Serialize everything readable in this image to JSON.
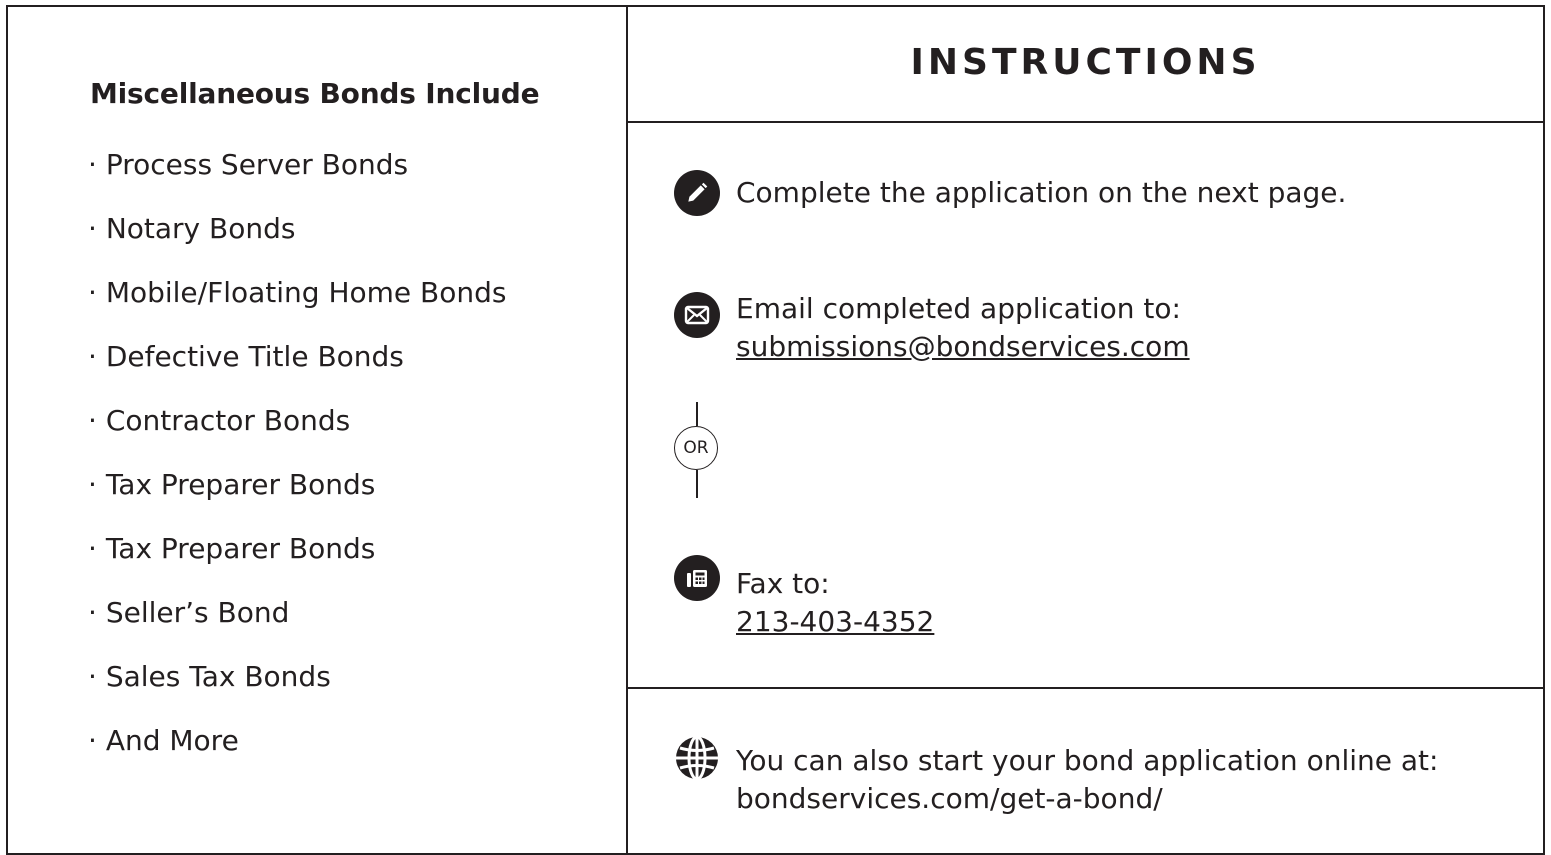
{
  "left": {
    "heading": "Miscellaneous Bonds Include",
    "items": [
      "Process Server Bonds",
      "Notary Bonds",
      "Mobile/Floating Home Bonds",
      "Defective Title Bonds",
      "Contractor Bonds",
      "Tax Preparer Bonds",
      "Tax Preparer Bonds",
      "Seller’s Bond",
      "Sales Tax Bonds",
      "And More"
    ]
  },
  "instructions": {
    "title": "INSTRUCTIONS",
    "step_complete": {
      "icon": "pencil-icon",
      "text": "Complete the application on the next page."
    },
    "step_email": {
      "icon": "envelope-icon",
      "text": "Email completed application to:",
      "link": "submissions@bondservices.com"
    },
    "or_label": "OR",
    "step_fax": {
      "icon": "fax-icon",
      "text": "Fax to:",
      "link": "213-403-4352"
    },
    "online": {
      "icon": "globe-icon",
      "text": "You can also start your bond application online at:",
      "url": "bondservices.com/get-a-bond/"
    }
  }
}
